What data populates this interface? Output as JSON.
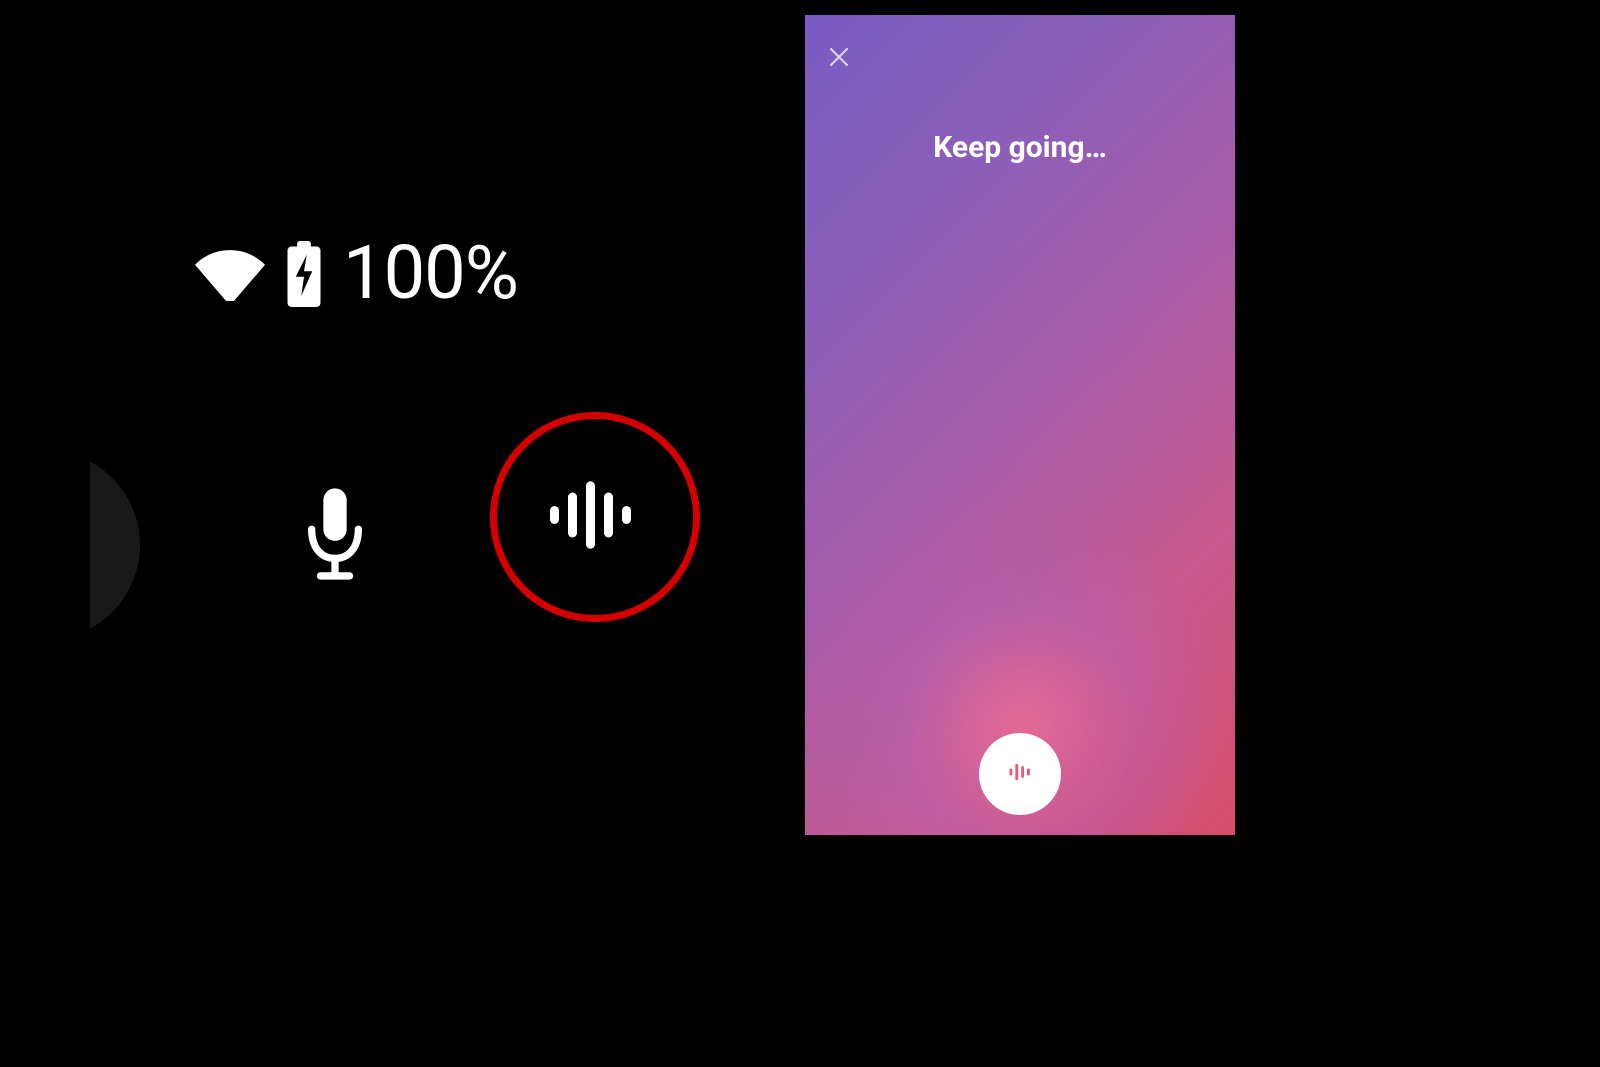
{
  "status": {
    "battery_level": "100%"
  },
  "voice_panel": {
    "prompt": "Keep going…"
  },
  "icons": {
    "wifi": "wifi-icon",
    "battery": "battery-charging-icon",
    "mic": "microphone-icon",
    "sound": "sound-search-icon",
    "close": "close-icon",
    "record": "waveform-icon"
  },
  "colors": {
    "highlight_ring": "#d40000",
    "gradient_start": "#7a5cc4",
    "gradient_end": "#d54d6a",
    "record_waveform": "#e85a7a"
  }
}
